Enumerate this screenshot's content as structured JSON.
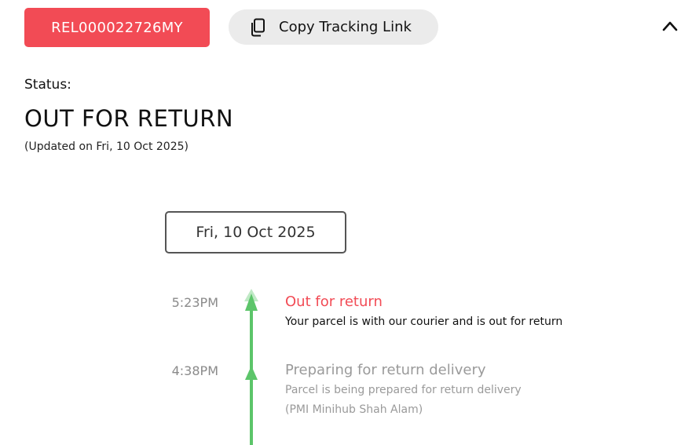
{
  "header": {
    "tracking_number": "REL000022726MY",
    "copy_button_label": "Copy Tracking Link",
    "colors": {
      "accent": "#f24b55",
      "timeline": "#5cc56a"
    }
  },
  "status": {
    "label": "Status:",
    "value": "OUT FOR RETURN",
    "updated": "(Updated on Fri, 10 Oct 2025)"
  },
  "timeline": {
    "date": "Fri, 10 Oct 2025",
    "events": [
      {
        "time": "5:23PM",
        "title": "Out for return",
        "description": "Your parcel is with our courier and is out for return"
      },
      {
        "time": "4:38PM",
        "title": "Preparing for return delivery",
        "description": "Parcel is being prepared for return delivery",
        "location": "(PMI Minihub Shah Alam)"
      }
    ]
  }
}
